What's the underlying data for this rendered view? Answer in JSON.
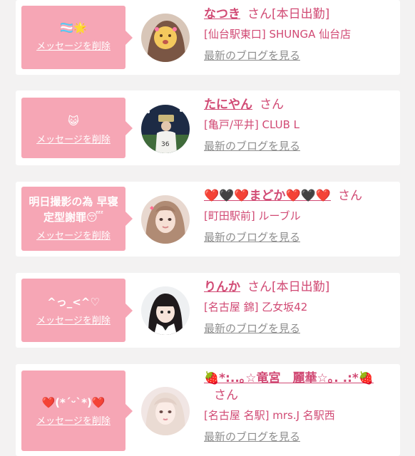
{
  "entries": [
    {
      "message": "🏳️‍⚧️🌟",
      "delete_label": "メッセージを削除",
      "name": "なつき",
      "suffix": "さん",
      "badge": "[本日出勤]",
      "shop": "[仙台駅東口] SHUNGA 仙台店",
      "blog_label": "最新のブログを見る"
    },
    {
      "message": "😺",
      "delete_label": "メッセージを削除",
      "name": "たにやん",
      "suffix": "さん",
      "badge": "",
      "shop": "[亀戸/平井] CLUB L",
      "blog_label": "最新のブログを見る"
    },
    {
      "message": "明日撮影の為 早寝定型謝罪😴",
      "delete_label": "メッセージを削除",
      "name": "❤️🖤❤️まどか❤️🖤❤️",
      "suffix": "さん",
      "badge": "",
      "shop": "[町田駅前] ルーブル",
      "blog_label": "最新のブログを見る"
    },
    {
      "message": "^っ_<^♡",
      "delete_label": "メッセージを削除",
      "name": "りんか",
      "suffix": "さん",
      "badge": "[本日出勤]",
      "shop": "[名古屋 錦] 乙女坂42",
      "blog_label": "最新のブログを見る"
    },
    {
      "message": "❤️(*´ᵕ`*)❤️",
      "delete_label": "メッセージを削除",
      "name": "🍓*:..｡☆竜宮　麗華☆｡. .:*🍓",
      "suffix": "さん",
      "badge": "",
      "shop": "[名古屋 名駅] mrs.J 名駅西",
      "blog_label": "最新のブログを見る"
    }
  ],
  "colors": {
    "background": "#f3f2f2",
    "card": "#ffffff",
    "bubble": "#f6a6b5",
    "accent": "#d14a74",
    "muted": "#8e8e8e"
  }
}
